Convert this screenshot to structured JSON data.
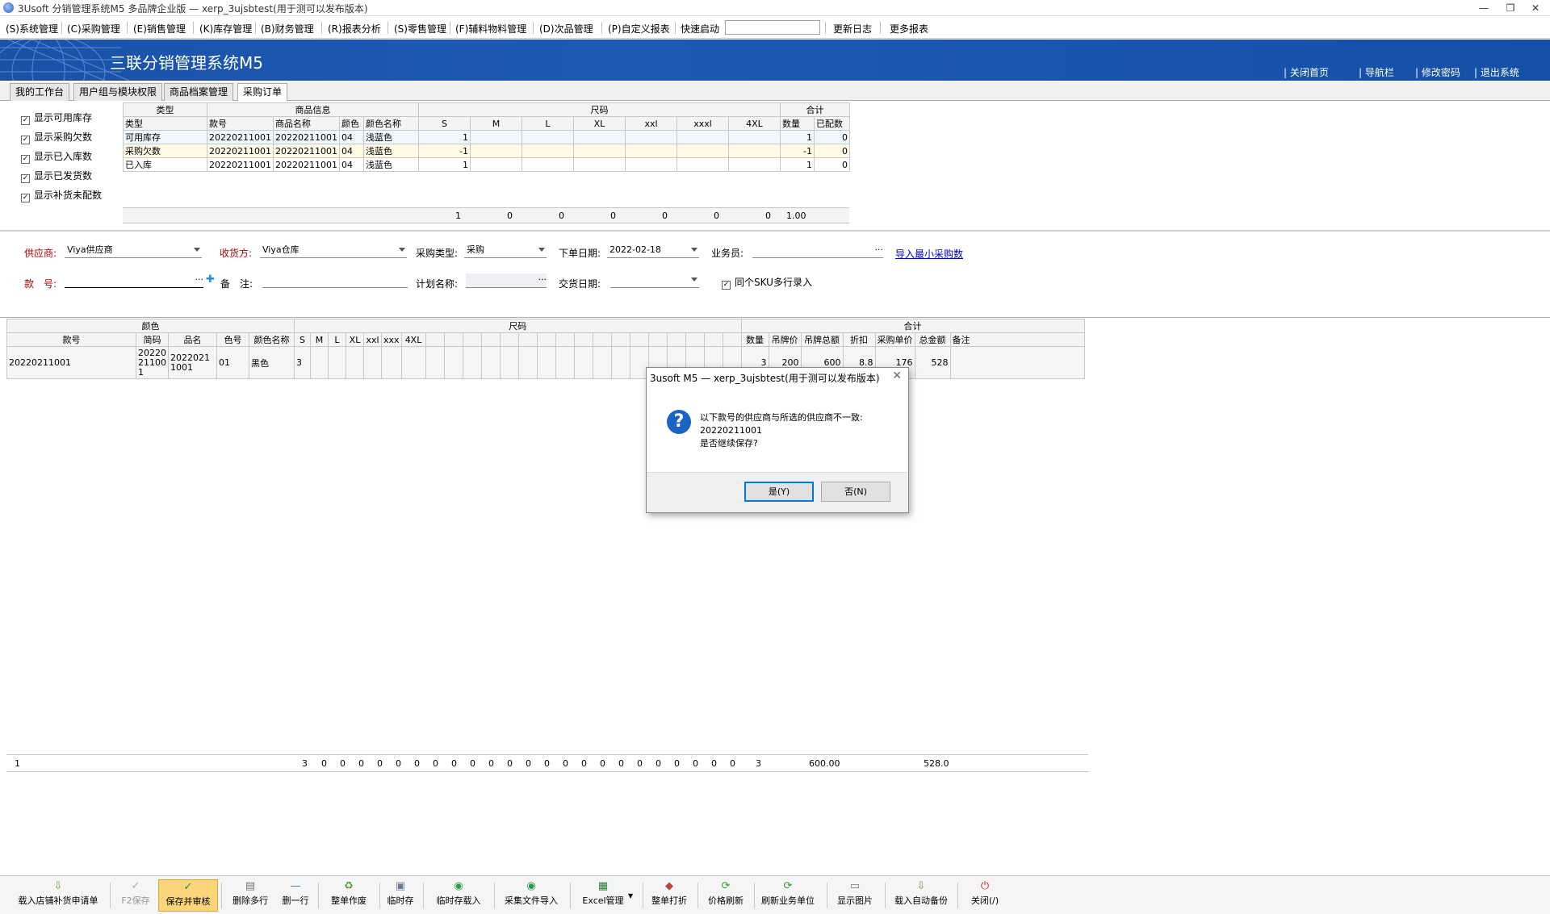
{
  "window": {
    "title": "3Usoft 分销管理系统M5 多品牌企业版 — xerp_3ujsbtest(用于测可以发布版本)",
    "minimize": "—",
    "restore": "❐",
    "close": "✕"
  },
  "menu": {
    "items": [
      "(S)系统管理",
      "(C)采购管理",
      "(E)销售管理",
      "(K)库存管理",
      "(B)财务管理",
      "(R)报表分析",
      "(S)零售管理",
      "(F)辅料物料管理",
      "(D)次品管理",
      "(P)自定义报表"
    ],
    "quick_start_label": "快速启动",
    "quick_start_value": "",
    "changelog": "更新日志",
    "more_reports": "更多报表"
  },
  "banner": {
    "title": "三联分销管理系统M5",
    "links": [
      "关闭首页",
      "导航栏",
      "修改密码",
      "退出系统"
    ]
  },
  "tabs": [
    "我的工作台",
    "用户组与模块权限",
    "商品档案管理",
    "采购订单"
  ],
  "options": [
    {
      "label": "显示可用库存",
      "checked": true
    },
    {
      "label": "显示采购欠数",
      "checked": true
    },
    {
      "label": "显示已入库数",
      "checked": true
    },
    {
      "label": "显示已发货数",
      "checked": true
    },
    {
      "label": "显示补货未配数",
      "checked": true
    }
  ],
  "stock_table": {
    "group_headers": [
      "类型",
      "商品信息",
      "尺码",
      "合计"
    ],
    "columns": [
      "类型",
      "款号",
      "商品名称",
      "颜色",
      "颜色名称",
      "S",
      "M",
      "L",
      "XL",
      "xxl",
      "xxxl",
      "4XL",
      "数量",
      "已配数"
    ],
    "rows": [
      [
        "可用库存",
        "20220211001",
        "20220211001",
        "04",
        "浅蓝色",
        "1",
        "",
        "",
        "",
        "",
        "",
        "",
        "1",
        "0"
      ],
      [
        "采购欠数",
        "20220211001",
        "20220211001",
        "04",
        "浅蓝色",
        "-1",
        "",
        "",
        "",
        "",
        "",
        "",
        "-1",
        "0"
      ],
      [
        "已入库",
        "20220211001",
        "20220211001",
        "04",
        "浅蓝色",
        "1",
        "",
        "",
        "",
        "",
        "",
        "",
        "1",
        "0"
      ]
    ],
    "footer": [
      "1",
      "0",
      "0",
      "0",
      "0",
      "0",
      "0",
      "1.00"
    ]
  },
  "form": {
    "supplier_label": "供应商:",
    "supplier_value": "Viya供应商",
    "receiver_label": "收货方:",
    "receiver_value": "Viya仓库",
    "purchase_type_label": "采购类型:",
    "purchase_type_value": "采购",
    "order_date_label": "下单日期:",
    "order_date_value": "2022-02-18",
    "salesman_label": "业务员:",
    "salesman_value": "",
    "import_link": "导入最小采购数",
    "style_no_label": "款　号:",
    "style_no_value": "",
    "remark_label": "备　注:",
    "remark_value": "",
    "plan_name_label": "计划名称:",
    "plan_name_value": "",
    "delivery_date_label": "交货日期:",
    "delivery_date_value": "",
    "multi_sku_label": "同个SKU多行录入",
    "multi_sku_checked": true
  },
  "detail_table": {
    "group_headers": [
      "颜色",
      "尺码",
      "合计"
    ],
    "columns": [
      "款号",
      "简码",
      "品名",
      "色号",
      "颜色名称",
      "S",
      "M",
      "L",
      "XL",
      "xxl",
      "xxx",
      "4XL",
      "数量",
      "吊牌价",
      "吊牌总额",
      "折扣",
      "采购单价",
      "总金额",
      "备注"
    ],
    "rows": [
      {
        "style": "20220211001",
        "code": "20220211001",
        "name": "20220211001",
        "color_no": "01",
        "color_name": "黑色",
        "S": "3",
        "qty": "3",
        "tag_price": "200",
        "tag_total": "600",
        "discount": "8.8",
        "unit_price": "176",
        "amount": "528",
        "note": ""
      }
    ],
    "footer": {
      "count": "1",
      "size_totals": [
        "3",
        "0",
        "0",
        "0",
        "0",
        "0",
        "0",
        "0",
        "0",
        "0",
        "0",
        "0",
        "0",
        "0",
        "0",
        "0",
        "0",
        "0",
        "0",
        "0",
        "0",
        "0",
        "0",
        "0"
      ],
      "qty": "3",
      "tag_total": "600.00",
      "amount": "528.0"
    }
  },
  "toolbar": [
    {
      "label": "载入店铺补货申请单",
      "icon": "load-icon"
    },
    {
      "label": "F2保存",
      "icon": "check-icon",
      "disabled": true
    },
    {
      "label": "保存并审核",
      "icon": "check-icon",
      "highlight": true
    },
    {
      "label": "删除多行",
      "icon": "delete-rows-icon"
    },
    {
      "label": "删一行",
      "icon": "minus-icon"
    },
    {
      "label": "整单作废",
      "icon": "trash-icon"
    },
    {
      "label": "临时存",
      "icon": "save-icon"
    },
    {
      "label": "临时存载入",
      "icon": "load-icon"
    },
    {
      "label": "采集文件导入",
      "icon": "import-icon"
    },
    {
      "label": "Excel管理",
      "icon": "excel-icon"
    },
    {
      "label": "整单打折",
      "icon": "discount-icon"
    },
    {
      "label": "价格刷新",
      "icon": "refresh-icon"
    },
    {
      "label": "刷新业务单位",
      "icon": "refresh-icon"
    },
    {
      "label": "显示图片",
      "icon": "image-icon"
    },
    {
      "label": "载入自动备份",
      "icon": "load-icon"
    },
    {
      "label": "关闭(/)",
      "icon": "power-icon"
    }
  ],
  "dialog": {
    "title": "3usoft M5 — xerp_3ujsbtest(用于测可以发布版本)",
    "message_line1": "以下款号的供应商与所选的供应商不一致:",
    "message_line2": "20220211001",
    "message_line3": "是否继续保存?",
    "yes": "是(Y)",
    "no": "否(N)"
  }
}
